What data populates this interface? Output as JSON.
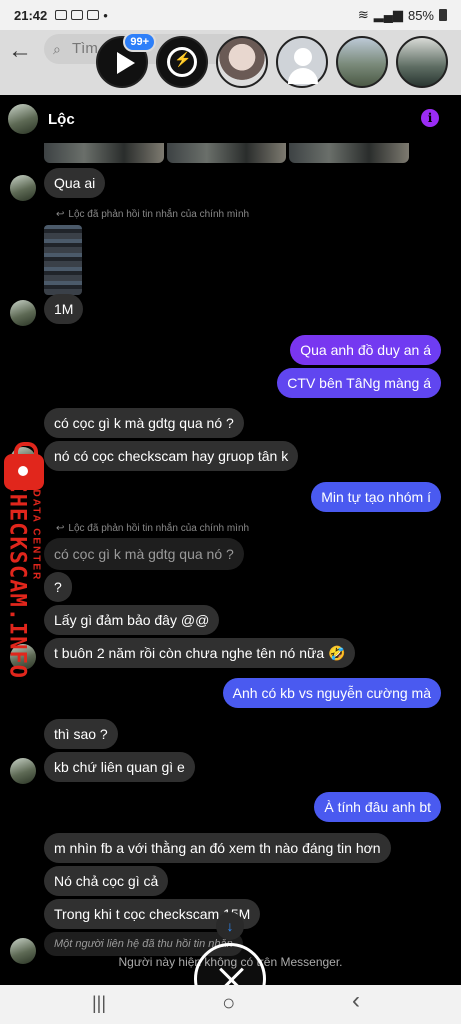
{
  "status_bar": {
    "time": "21:42",
    "dot": "•",
    "battery": "85%"
  },
  "header": {
    "search_placeholder": "Tìm",
    "badge": "99+"
  },
  "chat": {
    "name": "Lộc",
    "info_icon": "i",
    "reply_note": "Lộc đã phản hồi tin nhắn của chính mình",
    "messages": [
      "Qua ai",
      "1M",
      "Qua anh đồ duy an á",
      "CTV bên TâNg màng á",
      "có cọc gì k mà gdtg qua nó ?",
      "nó có cọc checkscam hay gruop tân k",
      "Min tự tạo nhóm í",
      "có cọc gì k mà gdtg qua nó ?",
      "?",
      "Lấy gì đảm bảo đây @@",
      "t buôn 2 năm rồi còn chưa nghe tên nó nữa 🤣",
      "Anh có kb vs nguyễn cường mà",
      "thì sao ?",
      "kb chứ liên quan gì e",
      "À tính đâu anh bt",
      "m nhìn fb a với thằng an đó xem th nào đáng tin hơn",
      "Nó chả cọc gì cả",
      "Trong khi t cọc checkscam 15M",
      "Một người liên hệ đã thu hồi tin nhắn"
    ],
    "footer": "Người này hiện không có trên Messenger.",
    "scroll_arrow": "↓"
  },
  "watermark": {
    "main": "CHECKSCAM.INFO",
    "sub": "DATA CENTER"
  },
  "nav": {
    "recents": "|||",
    "home": "○",
    "back": "‹"
  },
  "icons": {
    "back": "back-arrow-icon",
    "search": "search-icon",
    "info": "info-icon",
    "close": "close-icon"
  }
}
